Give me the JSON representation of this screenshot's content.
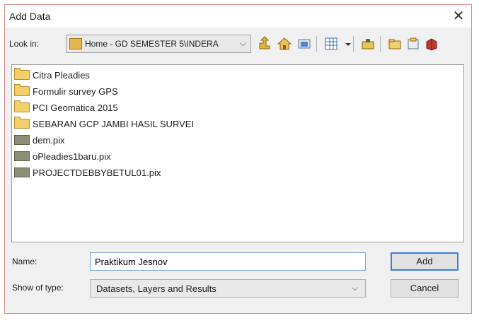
{
  "window": {
    "title": "Add Data",
    "close_glyph": "✕"
  },
  "lookin": {
    "label": "Look in:",
    "value": "Home - GD SEMESTER 5\\INDERA",
    "icon": "home-folder-icon"
  },
  "toolbar": {
    "icons": [
      "up-one-level-icon",
      "home-icon",
      "connect-folder-icon",
      "view-list-icon",
      "dropdown-arrow-icon",
      "go-to-catalog-icon",
      "new-folder-icon",
      "new-shapefile-icon",
      "new-geodatabase-icon"
    ]
  },
  "files": [
    {
      "name": "Citra Pleadies",
      "type": "folder"
    },
    {
      "name": "Formulir survey GPS",
      "type": "folder"
    },
    {
      "name": "PCI Geomatica 2015",
      "type": "folder"
    },
    {
      "name": "SEBARAN GCP JAMBI HASIL SURVEI",
      "type": "folder"
    },
    {
      "name": "dem.pix",
      "type": "raster"
    },
    {
      "name": "oPleadies1baru.pix",
      "type": "raster"
    },
    {
      "name": "PROJECTDEBBYBETUL01.pix",
      "type": "raster"
    }
  ],
  "name_field": {
    "label": "Name:",
    "value": "Praktikum Jesnov"
  },
  "type_field": {
    "label": "Show of type:",
    "value": "Datasets, Layers and Results"
  },
  "buttons": {
    "add": "Add",
    "cancel": "Cancel"
  }
}
